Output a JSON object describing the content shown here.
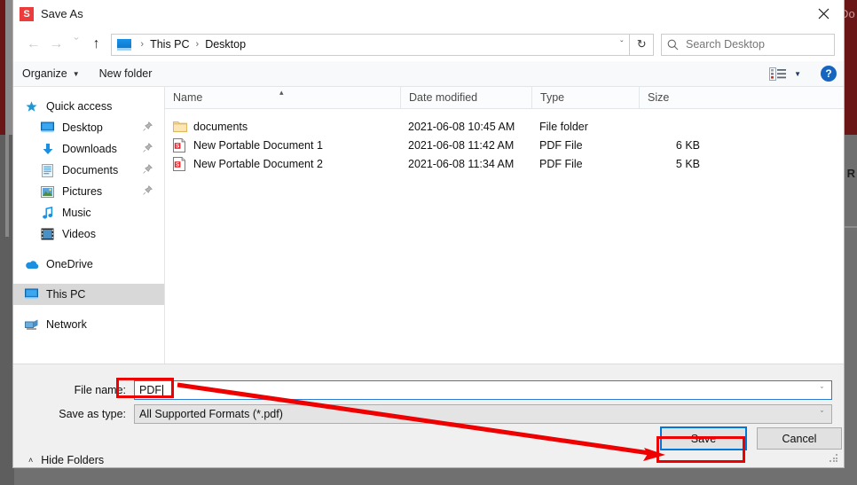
{
  "background": {
    "top_app_text": "Do",
    "bottom_app_text": "R"
  },
  "dialog": {
    "title": "Save As",
    "app_icon_letter": "S",
    "close_icon": "close-icon"
  },
  "navigation": {
    "back_label": "←",
    "forward_label": "→",
    "recent_label": "ˇ",
    "up_label": "↑",
    "breadcrumbs": [
      "This PC",
      "Desktop"
    ],
    "separator": "›",
    "dropdown_caret": "ˇ",
    "refresh_label": "↻",
    "search_placeholder": "Search Desktop"
  },
  "toolbar": {
    "organize_label": "Organize",
    "organize_caret": "▼",
    "new_folder_label": "New folder",
    "view_caret": "▼",
    "help_label": "?"
  },
  "sidebar": {
    "items": [
      {
        "label": "Quick access",
        "icon": "star-icon",
        "indent": false,
        "pinned": false,
        "selected": false
      },
      {
        "label": "Desktop",
        "icon": "desktop-icon",
        "indent": true,
        "pinned": true,
        "selected": false
      },
      {
        "label": "Downloads",
        "icon": "downloads-icon",
        "indent": true,
        "pinned": true,
        "selected": false
      },
      {
        "label": "Documents",
        "icon": "documents-icon",
        "indent": true,
        "pinned": true,
        "selected": false
      },
      {
        "label": "Pictures",
        "icon": "pictures-icon",
        "indent": true,
        "pinned": true,
        "selected": false
      },
      {
        "label": "Music",
        "icon": "music-icon",
        "indent": true,
        "pinned": false,
        "selected": false
      },
      {
        "label": "Videos",
        "icon": "videos-icon",
        "indent": true,
        "pinned": false,
        "selected": false
      },
      {
        "label": "OneDrive",
        "icon": "onedrive-icon",
        "indent": false,
        "pinned": false,
        "selected": false
      },
      {
        "label": "This PC",
        "icon": "this-pc-icon",
        "indent": false,
        "pinned": false,
        "selected": true
      },
      {
        "label": "Network",
        "icon": "network-icon",
        "indent": false,
        "pinned": false,
        "selected": false
      }
    ],
    "pin_glyph": "📌"
  },
  "filelist": {
    "columns": [
      "Name",
      "Date modified",
      "Type",
      "Size"
    ],
    "sort_indicator": "▴",
    "rows": [
      {
        "name": "documents",
        "date": "2021-06-08 10:45 AM",
        "type": "File folder",
        "size": "",
        "icon": "folder-icon"
      },
      {
        "name": "New Portable Document 1",
        "date": "2021-06-08 11:42 AM",
        "type": "PDF File",
        "size": "6 KB",
        "icon": "pdf-file-icon"
      },
      {
        "name": "New Portable Document 2",
        "date": "2021-06-08 11:34 AM",
        "type": "PDF File",
        "size": "5 KB",
        "icon": "pdf-file-icon"
      }
    ]
  },
  "form": {
    "filename_label": "File name:",
    "filename_value": "PDF",
    "savetype_label": "Save as type:",
    "savetype_value": "All Supported Formats (*.pdf)",
    "combo_caret": "ˇ",
    "hide_folders_label": "Hide Folders",
    "hide_folders_caret": "˄",
    "save_label": "Save",
    "cancel_label": "Cancel"
  },
  "annotations": {
    "highlight_color": "#ee0000",
    "focus_color": "#0078d7"
  }
}
